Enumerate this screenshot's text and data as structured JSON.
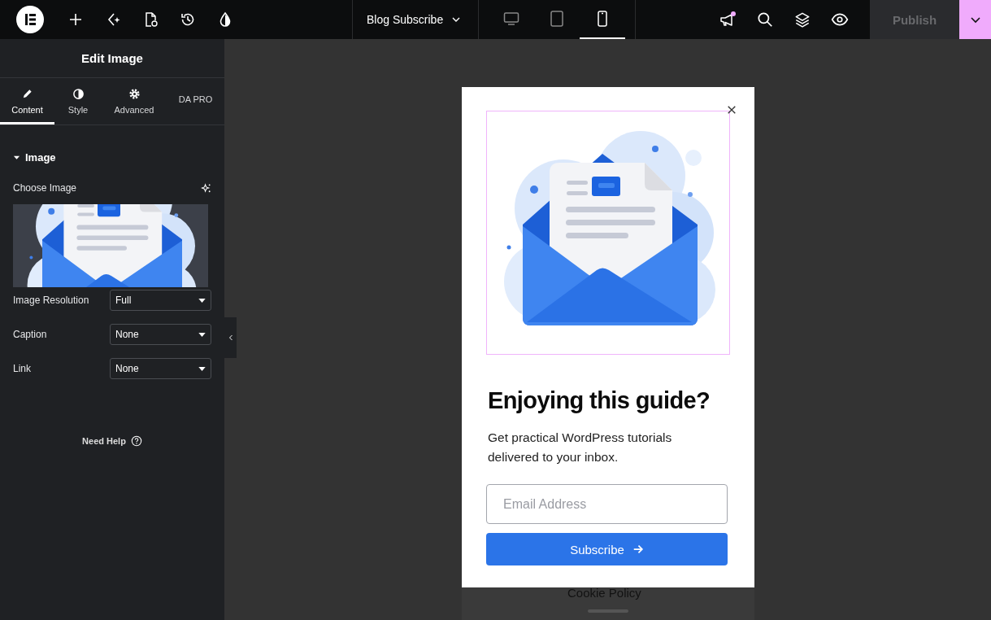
{
  "topbar": {
    "page_selector": "Blog Subscribe",
    "devices": [
      {
        "kind": "desktop",
        "selected": false
      },
      {
        "kind": "tablet",
        "selected": false
      },
      {
        "kind": "mobile",
        "selected": true
      }
    ],
    "notification": true,
    "publish": {
      "label": "Publish",
      "disabled": true
    }
  },
  "panel": {
    "title": "Edit Image",
    "tabs": [
      {
        "kind": "content",
        "label": "Content",
        "selected": true
      },
      {
        "kind": "style",
        "label": "Style",
        "selected": false
      },
      {
        "kind": "advanced",
        "label": "Advanced",
        "selected": false
      },
      {
        "kind": "text",
        "label": "DA PRO",
        "selected": false
      }
    ],
    "section": {
      "title": "Image",
      "expanded": true
    },
    "choose_image": "Choose Image",
    "fields": [
      {
        "label": "Image Resolution",
        "value": "Full"
      },
      {
        "label": "Caption",
        "value": "None"
      },
      {
        "label": "Link",
        "value": "None"
      }
    ],
    "help": "Need Help"
  },
  "popup": {
    "heading": "Enjoying this guide?",
    "text": "Get practical WordPress tutorials delivered to your inbox.",
    "email_placeholder": "Email Address",
    "button": "Subscribe"
  },
  "page_footer": "Cookie Policy"
}
